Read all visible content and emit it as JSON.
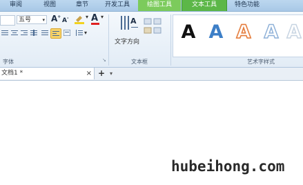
{
  "menu_tabs": [
    "审阅",
    "视图",
    "章节",
    "开发工具",
    "绘图工具",
    "文本工具",
    "特色功能"
  ],
  "font": {
    "size_value": "五号",
    "grow_label": "A",
    "shrink_label": "A",
    "color_label": "A",
    "group_label": "字体"
  },
  "textbox": {
    "direction_label": "文字方向",
    "group_label": "文本框"
  },
  "wordart": {
    "sample": "A",
    "group_label": "艺术字样式",
    "colors": [
      "#111111",
      "#3d7fc7",
      "#e47a3a",
      "#8fb1d8",
      "#c7d4e2"
    ]
  },
  "document": {
    "tab_title": "文档1 *",
    "close": "×",
    "new_tab": "+",
    "dropdown": "▾"
  },
  "watermark": "hubeihong.com",
  "colors": {
    "tab_highlight": "#5cb748",
    "ribbon_bg": "#e2ecf6"
  }
}
